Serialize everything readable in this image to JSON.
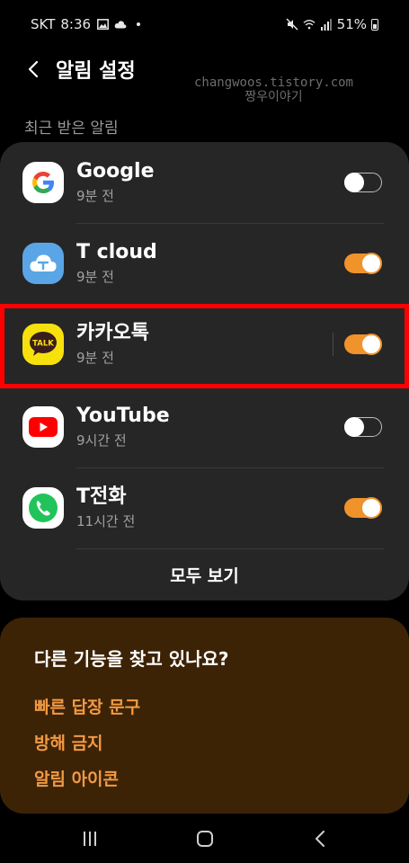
{
  "status": {
    "carrier": "SKT",
    "time": "8:36",
    "battery": "51%"
  },
  "header": {
    "title": "알림 설정"
  },
  "watermark": {
    "line1": "changwoos.tistory.com",
    "line2": "짱우이야기"
  },
  "recent": {
    "label": "최근 받은 알림",
    "apps": [
      {
        "name": "Google",
        "time": "9분 전",
        "enabled": false
      },
      {
        "name": "T cloud",
        "time": "9분 전",
        "enabled": true
      },
      {
        "name": "카카오톡",
        "time": "9분 전",
        "enabled": true,
        "icon_text": "TALK"
      },
      {
        "name": "YouTube",
        "time": "9시간 전",
        "enabled": false
      },
      {
        "name": "T전화",
        "time": "11시간 전",
        "enabled": true
      }
    ],
    "see_all": "모두 보기"
  },
  "other": {
    "title": "다른 기능을 찾고 있나요?",
    "links": [
      "빠른 답장 문구",
      "방해 금지",
      "알림 아이콘"
    ]
  },
  "colors": {
    "accent": "#f0932a",
    "link": "#f29a44",
    "highlight": "#ff0000",
    "card": "#262626",
    "card_brown": "#3d2306"
  }
}
